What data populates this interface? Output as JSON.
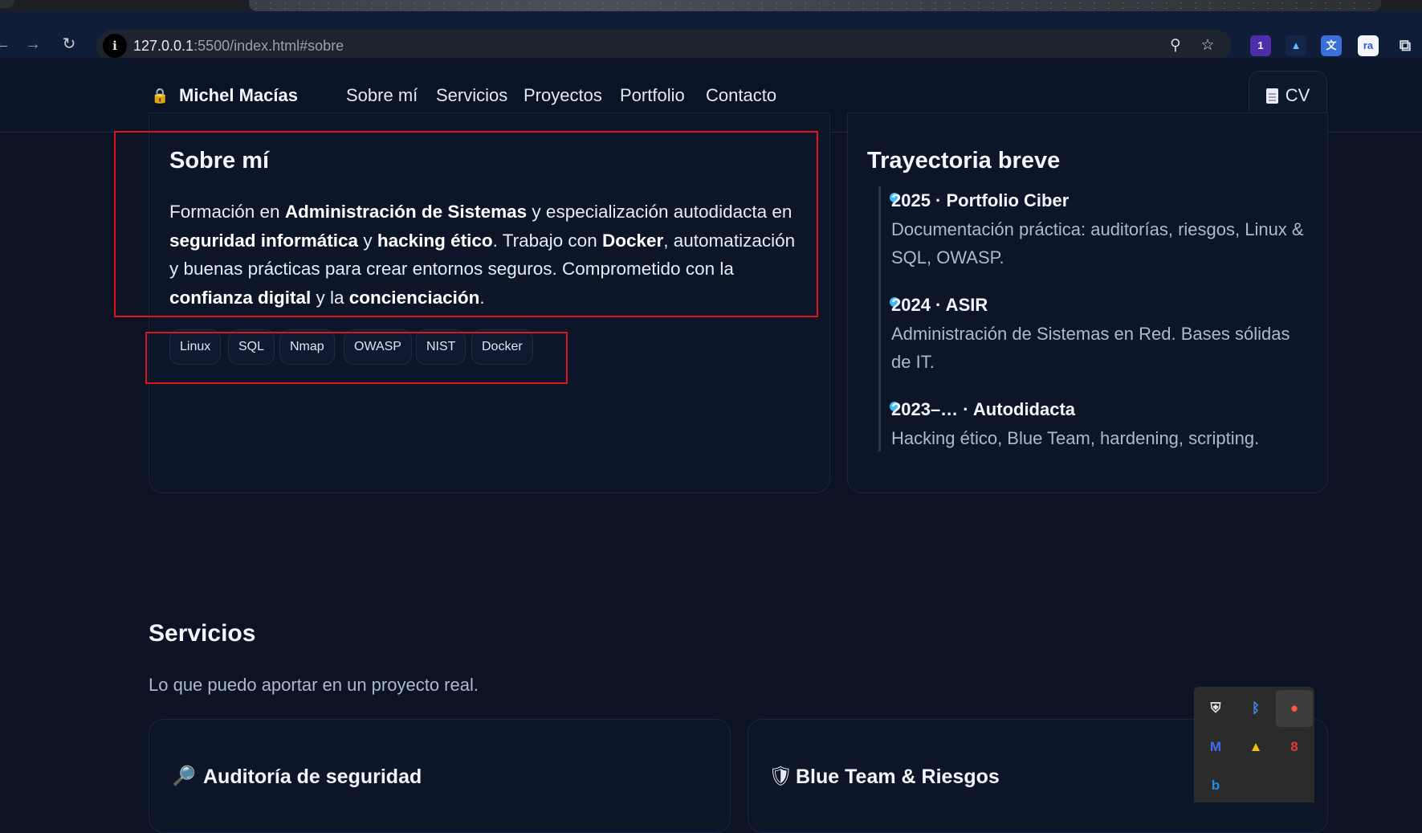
{
  "browser": {
    "url_host": "127.0.0.1",
    "url_rest": ":5500/index.html#sobre",
    "extension_badge": "1"
  },
  "header": {
    "brand": "Michel Macías",
    "nav": [
      "Sobre mí",
      "Servicios",
      "Proyectos",
      "Portfolio",
      "Contacto"
    ],
    "cv_label": "CV"
  },
  "about": {
    "title": "Sobre mí",
    "chips": [
      "Linux",
      "SQL",
      "Nmap",
      "OWASP",
      "NIST",
      "Docker"
    ]
  },
  "trajectory": {
    "title": "Trayectoria breve",
    "items": [
      {
        "title": "2025 · Portfolio Ciber",
        "desc": "Documentación práctica: auditorías, riesgos, Linux & SQL, OWASP."
      },
      {
        "title": "2024 · ASIR",
        "desc": "Administración de Sistemas en Red. Bases sólidas de IT."
      },
      {
        "title": "2023–… · Autodidacta",
        "desc": "Hacking ético, Blue Team, hardening, scripting."
      }
    ]
  },
  "services": {
    "title": "Servicios",
    "subtitle": "Lo que puedo aportar en un proyecto real.",
    "cards": [
      {
        "title": "Auditoría de seguridad",
        "icon": "magnifier-icon"
      },
      {
        "title": "Blue Team & Riesgos",
        "icon": "shield-icon"
      }
    ]
  },
  "colors": {
    "page_bg": "#0b1325",
    "accent_dot": "#38bdf8",
    "highlight_box": "#e0141c"
  }
}
